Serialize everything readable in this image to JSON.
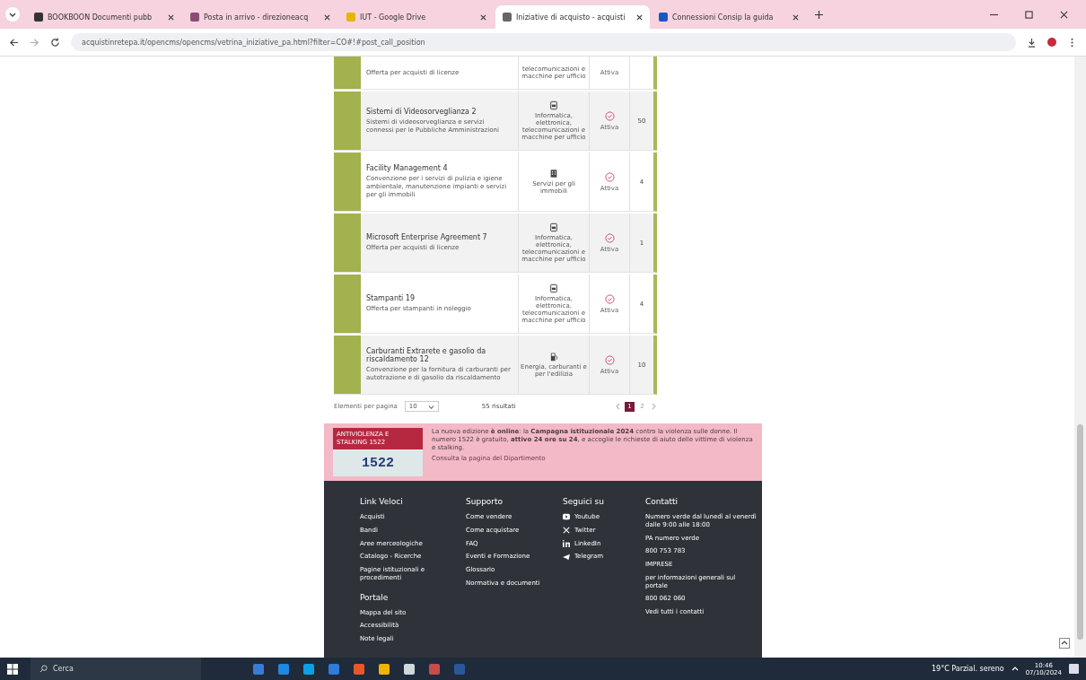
{
  "browser": {
    "tabs": [
      {
        "title": "BOOKBOON Documenti pubb",
        "selected": false
      },
      {
        "title": "Posta in arrivo - direzioneacq",
        "selected": false
      },
      {
        "title": "IUT - Google Drive",
        "selected": false
      },
      {
        "title": "Iniziative di acquisto - acquisti",
        "selected": true
      },
      {
        "title": "Connessioni Consip la guida",
        "selected": false
      }
    ],
    "url": "acquistinretepa.it/opencms/opencms/vetrina_iniziative_pa.html?filter=CO#!#post_call_position"
  },
  "initiatives": [
    {
      "partial": true,
      "description": "Offerta per acquisti di licenze",
      "category": "telecomunicazioni e macchine per ufficio",
      "status": "Attiva"
    },
    {
      "partial": false,
      "kind": "printer",
      "title": "Sistemi di Videosorveglianza 2",
      "description": "Sistemi di videosorveglianza e servizi connessi per le Pubbliche Amministrazioni",
      "category": "Informatica, elettronica, telecomunicazioni e macchine per ufficio",
      "status": "Attiva",
      "count": "50"
    },
    {
      "partial": false,
      "kind": "building",
      "title": "Facility Management 4",
      "description": "Convenzione per i servizi di pulizia e igiene ambientale, manutenzione impianti e servizi per gli immobili",
      "category": "Servizi per gli immobili",
      "status": "Attiva",
      "count": "4"
    },
    {
      "partial": false,
      "kind": "printer",
      "title": "Microsoft Enterprise Agreement 7",
      "description": "Offerta per acquisti di licenze",
      "category": "Informatica, elettronica, telecomunicazioni e macchine per ufficio",
      "status": "Attiva",
      "count": "1"
    },
    {
      "partial": false,
      "kind": "printer",
      "title": "Stampanti 19",
      "description": "Offerta per stampanti in noleggio",
      "category": "Informatica, elettronica, telecomunicazioni e macchine per ufficio",
      "status": "Attiva",
      "count": "4"
    },
    {
      "partial": false,
      "kind": "fuel",
      "title": "Carburanti Extrarete e gasolio da riscaldamento 12",
      "description": "Convenzione per la fornitura di carburanti per autotrazione e di gasolio da riscaldamento",
      "category": "Energia, carburanti e per l'edilizia",
      "status": "Attiva",
      "count": "10"
    }
  ],
  "pagination": {
    "per_page_label": "Elementi per pagina",
    "per_page": "10",
    "results": "55 risultati",
    "pages": [
      {
        "label": "1",
        "selected": true
      },
      {
        "label": "2",
        "selected": false
      }
    ]
  },
  "banner": {
    "badge_text": "ANTIVIOLENZA E STALKING 1522",
    "number": "1522",
    "text": "La nuova edizione **è online**: la **Campagna istituzionale 2024** contro la violenza sulle donne. Il numero 1522 è gratuito, **attivo 24 ore su 24**, e accoglie le richieste di aiuto delle vittime di violenza e stalking.",
    "link": "Consulta la pagina del Dipartimento"
  },
  "footer": {
    "columns": [
      {
        "heading": "Link Veloci",
        "links": [
          "Acquisti",
          "Bandi",
          "Aree merceologiche",
          "Catalogo - Ricerche",
          "Pagine istituzionali e procedimenti"
        ]
      },
      {
        "heading": "Supporto",
        "links": [
          "Come vendere",
          "Come acquistare",
          "FAQ",
          "Eventi e Formazione",
          "Glossario",
          "Normativa e documenti"
        ]
      },
      {
        "heading": "Seguici su",
        "social": [
          "Youtube",
          "Twitter",
          "LinkedIn",
          "Telegram"
        ]
      },
      {
        "heading": "Contatti",
        "contacts": [
          "Numero verde dal lunedì al venerdì dalle 9:00 alle 18:00",
          "PA numero verde",
          "800 753 783",
          "IMPRESE",
          "per informazioni generali sul portale",
          "800 062 060",
          "Vedi tutti i contatti"
        ]
      }
    ],
    "portal": {
      "heading": "Portale",
      "links": [
        "Mappa del sito",
        "Accessibilità",
        "Note legali"
      ]
    }
  },
  "taskbar": {
    "search": "Cerca",
    "weather": "19°C Parzial. sereno",
    "time": "10:46",
    "date": "07/10/2024"
  }
}
